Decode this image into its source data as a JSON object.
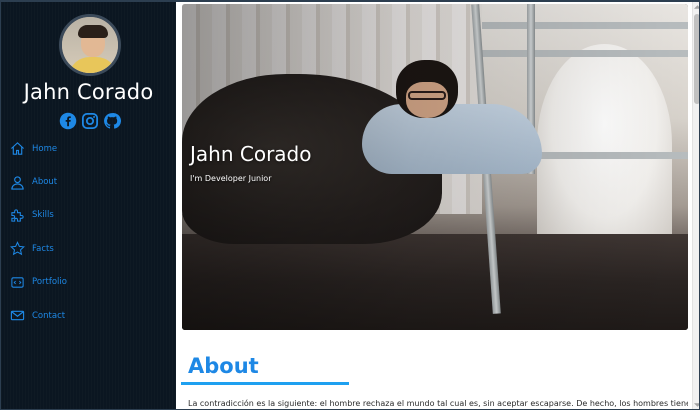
{
  "sidebar": {
    "name": "Jahn Corado",
    "socials": [
      {
        "icon": "facebook-icon",
        "color": "#1e88e5"
      },
      {
        "icon": "instagram-icon",
        "color": "#1e88e5"
      },
      {
        "icon": "github-icon",
        "color": "#1e88e5"
      }
    ],
    "nav": [
      {
        "label": "Home",
        "icon": "house-icon"
      },
      {
        "label": "About",
        "icon": "person-icon"
      },
      {
        "label": "Skills",
        "icon": "puzzle-icon"
      },
      {
        "label": "Facts",
        "icon": "star-icon"
      },
      {
        "label": "Portfolio",
        "icon": "portfolio-icon"
      },
      {
        "label": "Contact",
        "icon": "envelope-icon"
      }
    ]
  },
  "hero": {
    "title": "Jahn Corado",
    "subtitle": "I'm Developer Junior"
  },
  "about": {
    "heading": "About",
    "text": "La contradicción es la siguiente: el hombre rechaza el mundo tal cual es, sin aceptar escaparse. De hecho, los hombres tienen apego al"
  },
  "colors": {
    "accent": "#1e88e5",
    "sidebar_bg": "#0b1621",
    "rule": "#1ea0f0"
  }
}
